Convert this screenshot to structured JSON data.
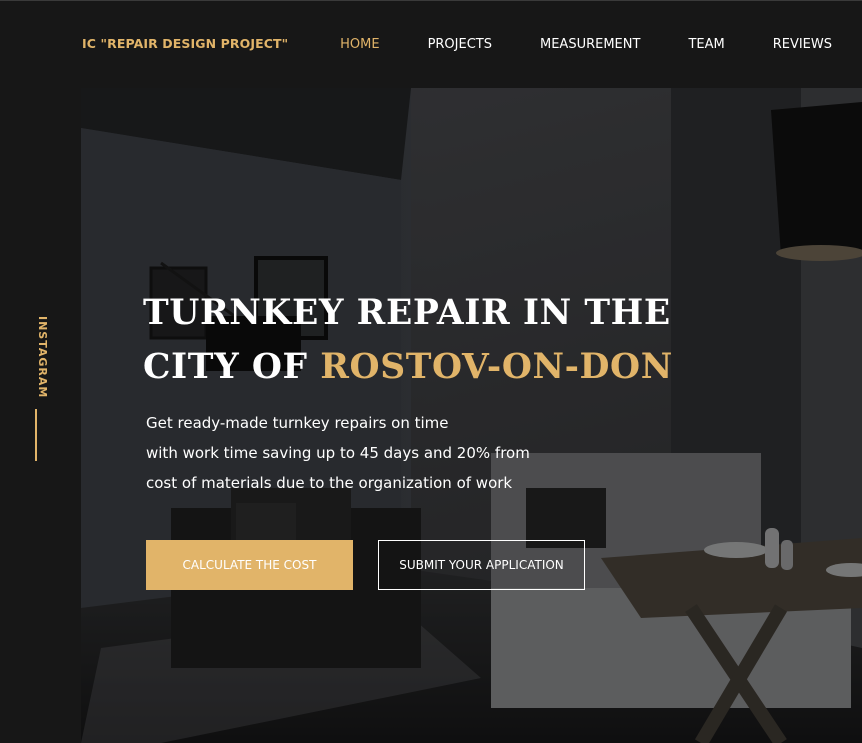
{
  "header": {
    "logo": "IC \"REPAIR DESIGN PROJECT\"",
    "nav": [
      {
        "label": "HOME",
        "active": true
      },
      {
        "label": "PROJECTS",
        "active": false
      },
      {
        "label": "MEASUREMENT",
        "active": false
      },
      {
        "label": "TEAM",
        "active": false
      },
      {
        "label": "REVIEWS",
        "active": false
      }
    ]
  },
  "sidebar": {
    "social_label": "INSTAGRAM"
  },
  "hero": {
    "title_line1": "TURNKEY REPAIR IN THE",
    "title_line2_prefix": "CITY OF ",
    "title_line2_accent": "ROSTOV-ON-DON",
    "description_lines": [
      "Get ready-made turnkey repairs on time",
      "with work time saving up to 45 days and 20% from",
      "cost of materials due to the organization of work"
    ],
    "primary_button": "CALCULATE THE COST",
    "secondary_button": "SUBMIT YOUR APPLICATION",
    "background_image": "dark-living-room-interior"
  },
  "colors": {
    "accent": "#e1b469",
    "background": "#171717",
    "text": "#ffffff"
  }
}
